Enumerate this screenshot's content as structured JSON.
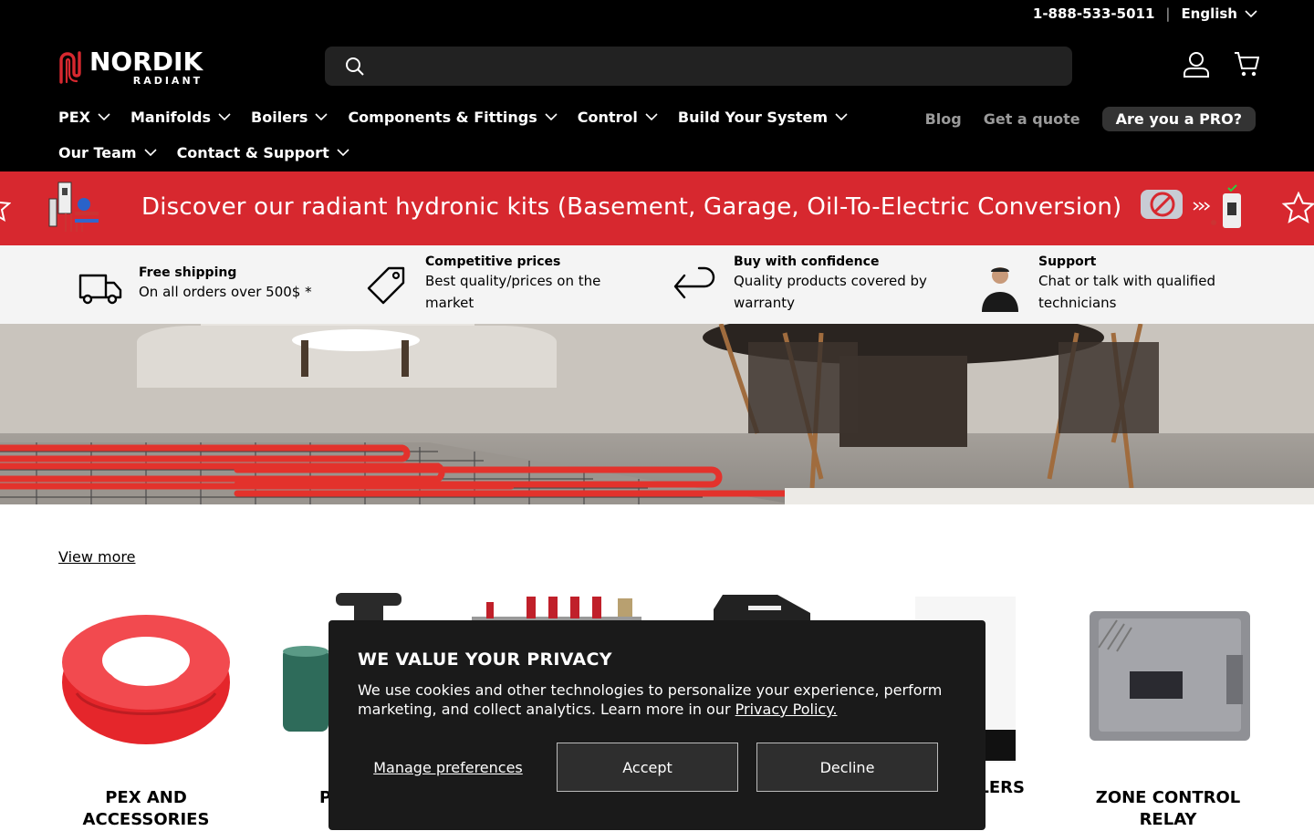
{
  "util": {
    "phone": "1-888-533-5011",
    "separator": "|",
    "language": "English"
  },
  "logo": {
    "word1": "NORDIK",
    "word2": "RADIANT"
  },
  "search": {
    "placeholder": ""
  },
  "nav": {
    "primary": [
      {
        "label": "PEX"
      },
      {
        "label": "Manifolds"
      },
      {
        "label": "Boilers"
      },
      {
        "label": "Components & Fittings"
      },
      {
        "label": "Control"
      },
      {
        "label": "Build Your System"
      }
    ],
    "secondary": [
      {
        "label": "Our Team"
      },
      {
        "label": "Contact & Support"
      }
    ],
    "right": {
      "blog": "Blog",
      "quote": "Get a quote",
      "pro": "Are you a PRO?"
    }
  },
  "banner": {
    "text": "Discover our radiant hydronic kits (Basement, Garage, Oil-To-Electric Conversion)"
  },
  "features": [
    {
      "title": "Free shipping",
      "text": "On all orders over 500$ *",
      "icon": "truck-icon"
    },
    {
      "title": "Competitive prices",
      "text": "Best quality/prices on the market",
      "icon": "price-tag-icon"
    },
    {
      "title": "Buy with confidence",
      "text": "Quality products covered by warranty",
      "icon": "return-arrow-icon"
    },
    {
      "title": "Support",
      "text": "Chat or talk with qualified technicians",
      "icon": "technician-avatar"
    }
  ],
  "view_more": "View more",
  "products": [
    {
      "label": "PEX AND ACCESSORIES"
    },
    {
      "label": "P"
    },
    {
      "label": "LERS"
    },
    {
      "label": "ZONE CONTROL RELAY"
    }
  ],
  "cookie": {
    "title": "WE VALUE YOUR PRIVACY",
    "text": "We use cookies and other technologies to personalize your experience, perform marketing, and collect analytics. Learn more in our ",
    "link": "Privacy Policy.",
    "manage": "Manage preferences",
    "accept": "Accept",
    "decline": "Decline"
  },
  "colors": {
    "brand_red": "#d7282f",
    "header_bg": "#000000",
    "features_bg": "#f4f4f4"
  }
}
